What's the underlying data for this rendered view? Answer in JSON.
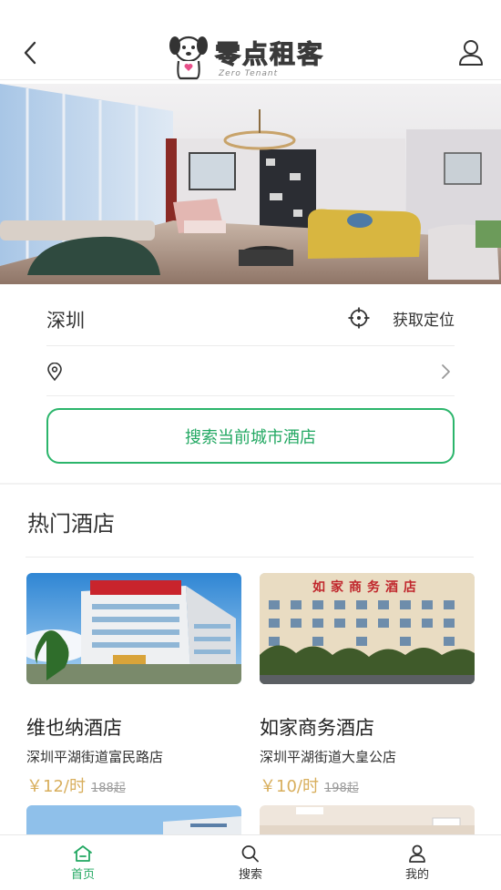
{
  "header": {
    "logo_text": "零点租客",
    "logo_sub": "Zero Tenant"
  },
  "location": {
    "city": "深圳",
    "locate_label": "获取定位",
    "address": ""
  },
  "search_button": "搜索当前城市酒店",
  "hot_section": {
    "title": "热门酒店",
    "hotels": [
      {
        "name": "维也纳酒店",
        "address": "深圳平湖街道富民路店",
        "price": "￥12/时",
        "original_price": "188起"
      },
      {
        "name": "如家商务酒店",
        "address": "深圳平湖街道大皇公店",
        "price": "￥10/时",
        "original_price": "198起"
      }
    ],
    "sign_text": "如家商务酒店"
  },
  "tabbar": {
    "items": [
      {
        "label": "首页"
      },
      {
        "label": "搜索"
      },
      {
        "label": "我的"
      }
    ]
  },
  "colors": {
    "accent": "#22a862",
    "price": "#d8ae5c"
  }
}
